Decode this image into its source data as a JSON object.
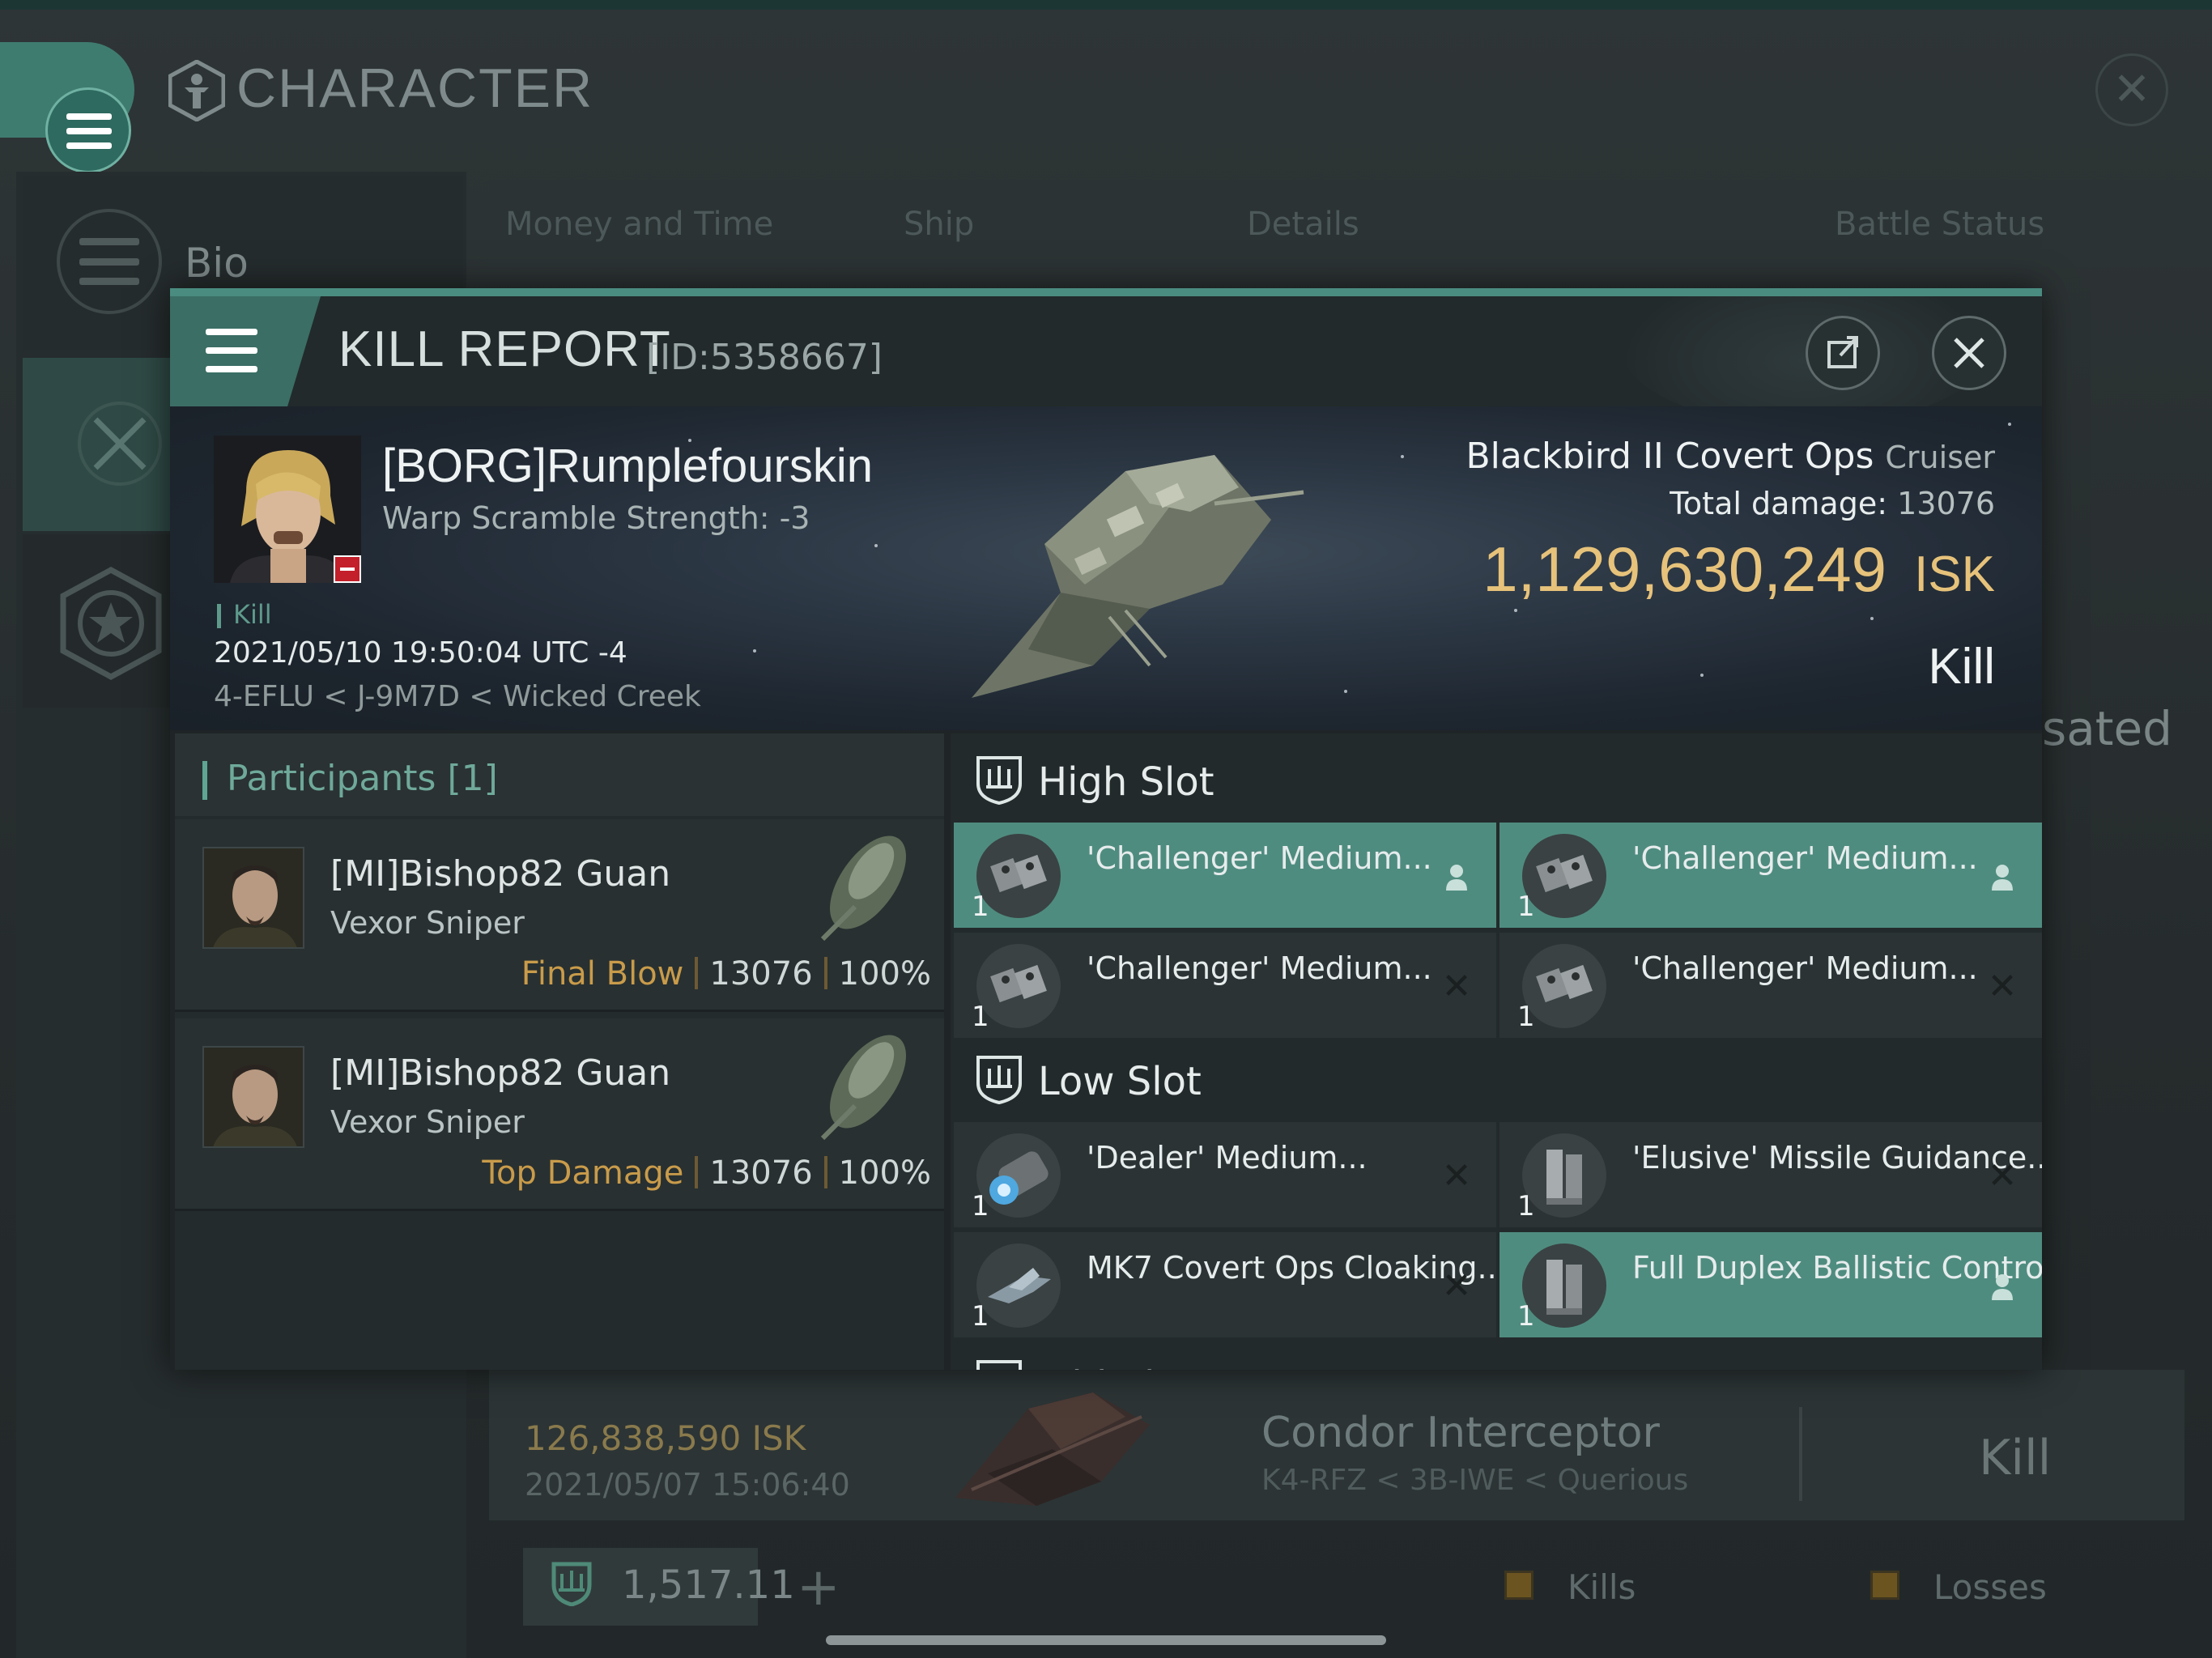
{
  "app": {
    "title": "CHARACTER",
    "rail": {
      "bio_label": "Bio"
    },
    "bg_tabs": [
      "Money and Time",
      "Ship",
      "Details",
      "Battle Status"
    ],
    "bg_partial_text": "sated",
    "bg_entry": {
      "isk": "126,838,590",
      "isk_unit": "ISK",
      "date": "2021/05/07  15:06:40",
      "ship_name": "Condor Interceptor",
      "route": "K4-RFZ < 3B-IWE < Querious",
      "result": "Kill"
    },
    "balance": {
      "value": "1,517.11",
      "plus": "+"
    },
    "legend": [
      "Kills",
      "Losses"
    ]
  },
  "modal": {
    "title": "KILL REPORT",
    "id": "[ID:5358667]",
    "victim": {
      "name": "[BORG]Rumplefourskin",
      "subtitle": "Warp Scramble Strength: -3",
      "tag": "Kill",
      "date": "2021/05/10 19:50:04 UTC -4",
      "route": "4-EFLU < J-9M7D < Wicked Creek"
    },
    "ship": {
      "name": "Blackbird II Covert Ops",
      "class": "Cruiser",
      "total_damage_label": "Total damage:",
      "total_damage": "13076",
      "isk_value": "1,129,630,249",
      "isk_unit": "ISK",
      "result": "Kill"
    },
    "participants": {
      "title": "Participants",
      "count": "[1]",
      "rows": [
        {
          "name": "[MI]Bishop82 Guan",
          "ship": "Vexor Sniper",
          "tag": "Final Blow",
          "damage": "13076",
          "percent": "100%"
        },
        {
          "name": "[MI]Bishop82 Guan",
          "ship": "Vexor Sniper",
          "tag": "Top Damage",
          "damage": "13076",
          "percent": "100%"
        }
      ]
    },
    "high_slot": {
      "title": "High Slot",
      "modules": [
        {
          "name": "'Challenger' Medium...",
          "qty": "1",
          "status": "dropped"
        },
        {
          "name": "'Challenger' Medium...",
          "qty": "1",
          "status": "dropped"
        },
        {
          "name": "'Challenger' Medium...",
          "qty": "1",
          "status": "destroyed"
        },
        {
          "name": "'Challenger' Medium...",
          "qty": "1",
          "status": "destroyed"
        }
      ]
    },
    "low_slot": {
      "title": "Low Slot",
      "modules": [
        {
          "name": "'Dealer' Medium...",
          "qty": "1",
          "status": "destroyed"
        },
        {
          "name": "'Elusive' Missile Guidance...",
          "qty": "1",
          "status": "destroyed"
        },
        {
          "name": "MK7 Covert Ops Cloaking...",
          "qty": "1",
          "status": "destroyed"
        },
        {
          "name": "Full Duplex Ballistic Control...",
          "qty": "1",
          "status": "dropped"
        }
      ]
    },
    "mid_slot": {
      "title": "Mid Slot"
    }
  },
  "colors": {
    "accent": "#4f8c80",
    "isk_gold": "#e6c27a",
    "final_blow": "#c99b4a"
  },
  "icons": [
    "hamburger-icon",
    "character-icon",
    "close-icon",
    "share-icon",
    "star-badge-icon",
    "crossed-swords-icon",
    "slot-shield-icon",
    "pilot-icon",
    "x-icon"
  ]
}
